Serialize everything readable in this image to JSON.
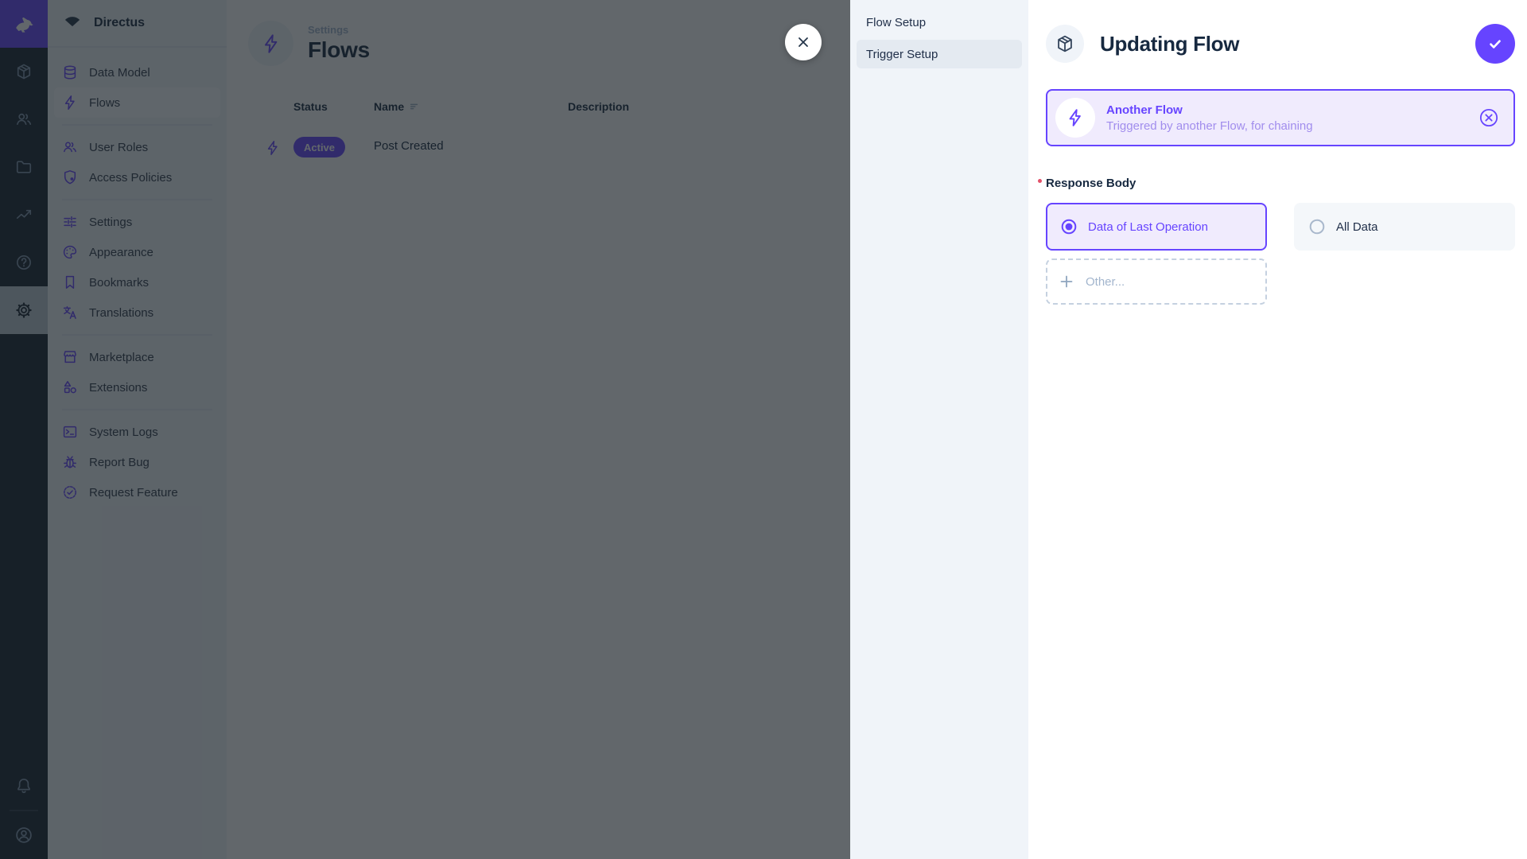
{
  "colors": {
    "accent": "#6644ff",
    "module_bar": "#18222f",
    "surface": "#f0f4f9",
    "required": "#e35169"
  },
  "module_bar": {
    "logo_icon": "directus-rabbit-icon",
    "modules": [
      {
        "icon": "box-icon",
        "active": false
      },
      {
        "icon": "users-icon",
        "active": false
      },
      {
        "icon": "folder-icon",
        "active": false
      },
      {
        "icon": "insights-icon",
        "active": false
      },
      {
        "icon": "help-icon",
        "active": false
      },
      {
        "icon": "settings-gear-icon",
        "active": true
      }
    ],
    "bottom": [
      {
        "icon": "bell-icon"
      },
      {
        "icon": "user-avatar-icon"
      }
    ]
  },
  "sidebar": {
    "project_name": "Directus",
    "items": [
      {
        "label": "Data Model",
        "icon": "database-icon"
      },
      {
        "label": "Flows",
        "icon": "bolt-icon",
        "active": true
      },
      {
        "label": "User Roles",
        "icon": "people-icon"
      },
      {
        "label": "Access Policies",
        "icon": "shield-badge-icon"
      },
      {
        "label": "Settings",
        "icon": "tune-icon"
      },
      {
        "label": "Appearance",
        "icon": "palette-icon"
      },
      {
        "label": "Bookmarks",
        "icon": "bookmark-icon"
      },
      {
        "label": "Translations",
        "icon": "translate-icon"
      },
      {
        "label": "Marketplace",
        "icon": "storefront-icon"
      },
      {
        "label": "Extensions",
        "icon": "shapes-icon"
      },
      {
        "label": "System Logs",
        "icon": "terminal-icon"
      },
      {
        "label": "Report Bug",
        "icon": "bug-icon"
      },
      {
        "label": "Request Feature",
        "icon": "seal-check-icon"
      }
    ]
  },
  "main": {
    "breadcrumb": "Settings",
    "title": "Flows",
    "table": {
      "columns": [
        "Status",
        "Name",
        "Description"
      ],
      "rows": [
        {
          "status": "Active",
          "name": "Post Created",
          "description": ""
        }
      ]
    }
  },
  "drawer": {
    "nav": [
      {
        "label": "Flow Setup",
        "active": false
      },
      {
        "label": "Trigger Setup",
        "active": true
      }
    ],
    "title": "Updating Flow",
    "trigger_card": {
      "title": "Another Flow",
      "subtitle": "Triggered by another Flow, for chaining"
    },
    "form": {
      "field_label": "Response Body",
      "required": true,
      "options": [
        {
          "label": "Data of Last Operation",
          "selected": true
        },
        {
          "label": "All Data",
          "selected": false
        }
      ],
      "other_label": "Other..."
    }
  }
}
